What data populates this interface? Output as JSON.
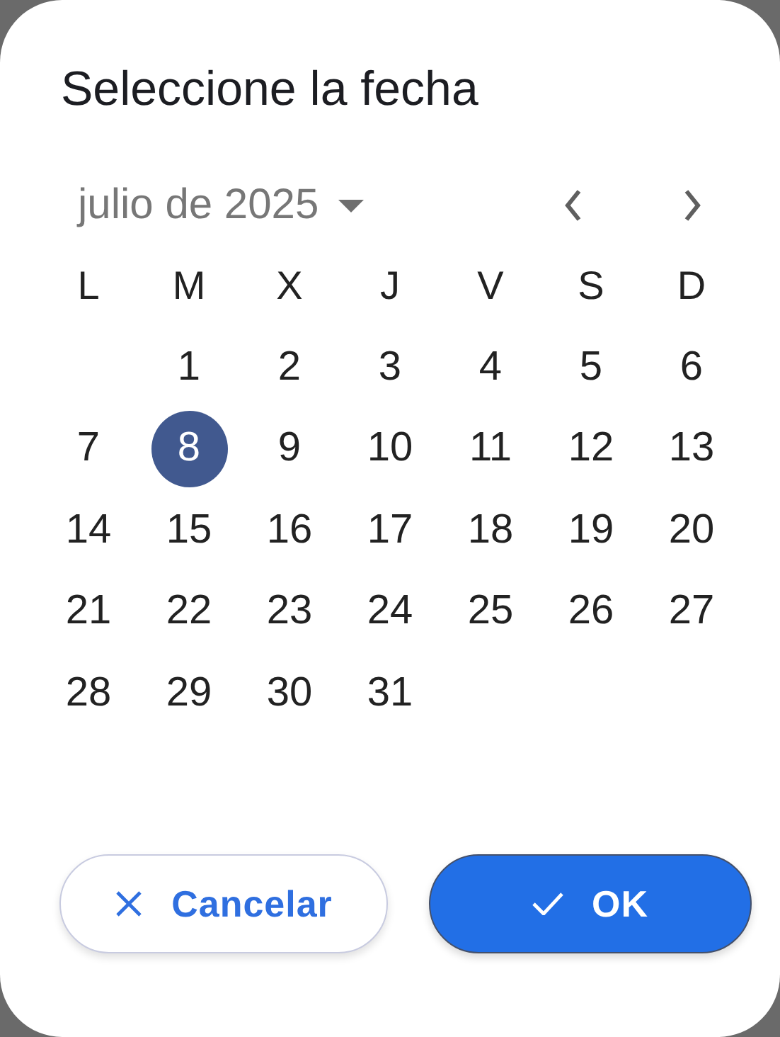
{
  "dialog": {
    "title": "Seleccione la fecha",
    "month_label": "julio de 2025",
    "weekdays": [
      "L",
      "M",
      "X",
      "J",
      "V",
      "S",
      "D"
    ],
    "weeks": [
      [
        {
          "label": "1",
          "selected": false
        },
        {
          "label": "2",
          "selected": false
        },
        {
          "label": "3",
          "selected": false
        },
        {
          "label": "4",
          "selected": false
        },
        {
          "label": "5",
          "selected": false
        },
        {
          "label": "6",
          "selected": false
        }
      ],
      [
        {
          "label": "7",
          "selected": false
        },
        {
          "label": "8",
          "selected": true
        },
        {
          "label": "9",
          "selected": false
        },
        {
          "label": "10",
          "selected": false
        },
        {
          "label": "11",
          "selected": false
        },
        {
          "label": "12",
          "selected": false
        },
        {
          "label": "13",
          "selected": false
        }
      ],
      [
        {
          "label": "14",
          "selected": false
        },
        {
          "label": "15",
          "selected": false
        },
        {
          "label": "16",
          "selected": false
        },
        {
          "label": "17",
          "selected": false
        },
        {
          "label": "18",
          "selected": false
        },
        {
          "label": "19",
          "selected": false
        },
        {
          "label": "20",
          "selected": false
        }
      ],
      [
        {
          "label": "21",
          "selected": false
        },
        {
          "label": "22",
          "selected": false
        },
        {
          "label": "23",
          "selected": false
        },
        {
          "label": "24",
          "selected": false
        },
        {
          "label": "25",
          "selected": false
        },
        {
          "label": "26",
          "selected": false
        },
        {
          "label": "27",
          "selected": false
        }
      ],
      [
        {
          "label": "28",
          "selected": false
        },
        {
          "label": "29",
          "selected": false
        },
        {
          "label": "30",
          "selected": false
        },
        {
          "label": "31",
          "selected": false
        }
      ]
    ],
    "buttons": [
      {
        "kind": "cancel",
        "label": "Cancelar"
      },
      {
        "kind": "ok",
        "label": "OK"
      }
    ]
  }
}
